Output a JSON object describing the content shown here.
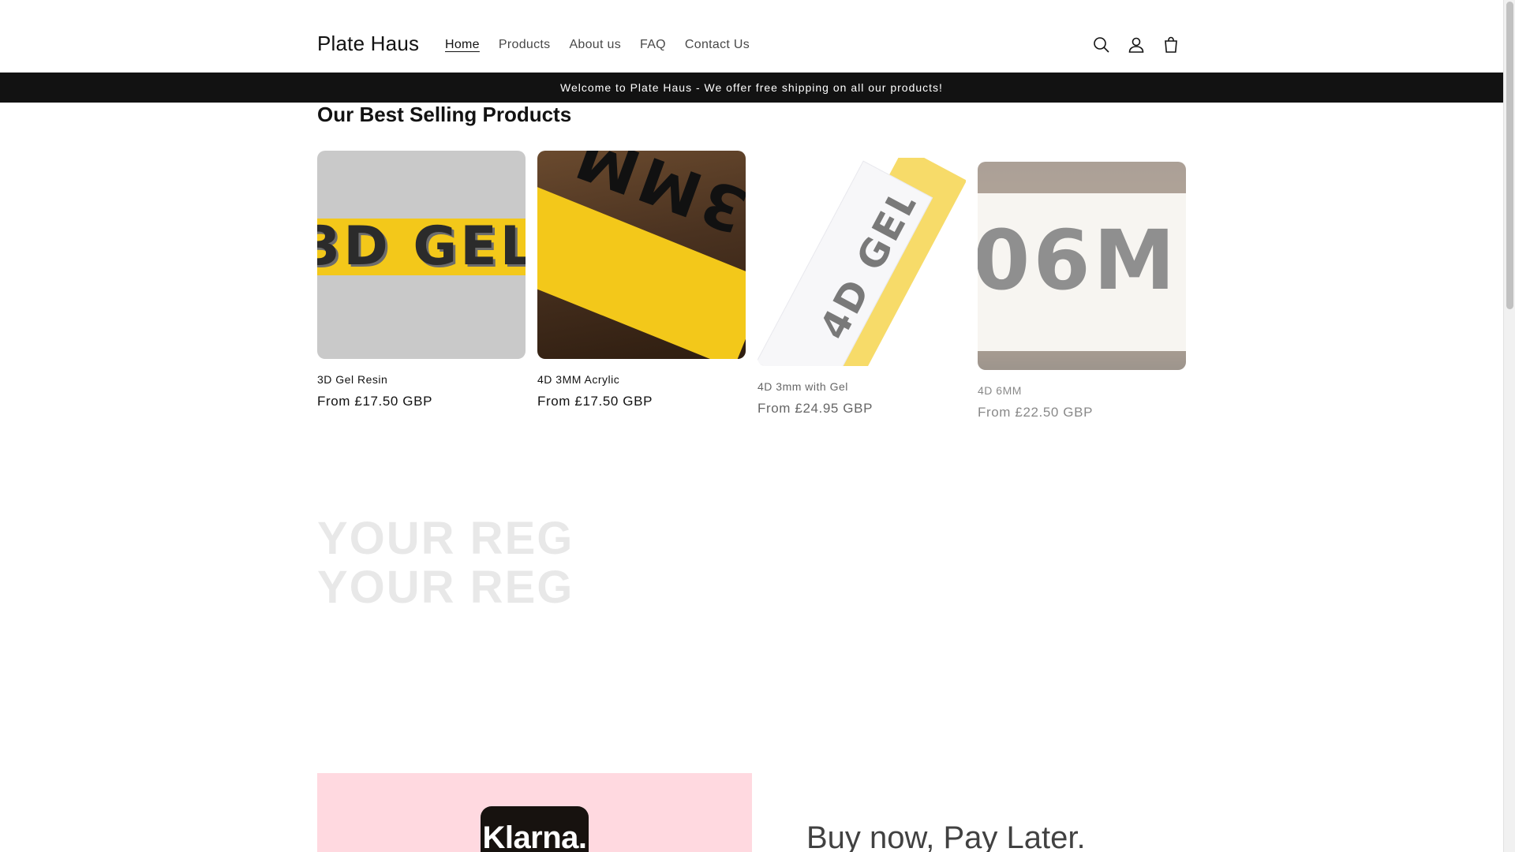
{
  "header": {
    "logo": "Plate Haus",
    "nav": [
      {
        "label": "Home",
        "active": true
      },
      {
        "label": "Products",
        "active": false
      },
      {
        "label": "About us",
        "active": false
      },
      {
        "label": "FAQ",
        "active": false
      },
      {
        "label": "Contact Us",
        "active": false
      }
    ],
    "icons": [
      "search-icon",
      "account-icon",
      "cart-icon"
    ]
  },
  "announcement": "Welcome to Plate Haus - We offer free shipping on all our products!",
  "featured": {
    "title": "Our Best Selling Products",
    "products": [
      {
        "name": "3D Gel Resin",
        "price": "From £17.50 GBP",
        "plate_text": "3D GEL"
      },
      {
        "name": "4D 3MM Acrylic",
        "price": "From £17.50 GBP",
        "plate_text": "3MM"
      },
      {
        "name": "4D 3mm with Gel",
        "price": "From £24.95 GBP",
        "plate_text": "4D GEL"
      },
      {
        "name": "4D 6MM",
        "price": "From £22.50 GBP",
        "plate_text": "06M"
      }
    ]
  },
  "faded": {
    "line1": "YOUR REG",
    "line2": "YOUR REG"
  },
  "klarna": {
    "logo_text": "Klarna.",
    "heading": "Buy now, Pay Later."
  },
  "colors": {
    "announcement_bg": "#121212",
    "plate_yellow": "#f3c81a",
    "klarna_pink": "#ffd9e0"
  }
}
